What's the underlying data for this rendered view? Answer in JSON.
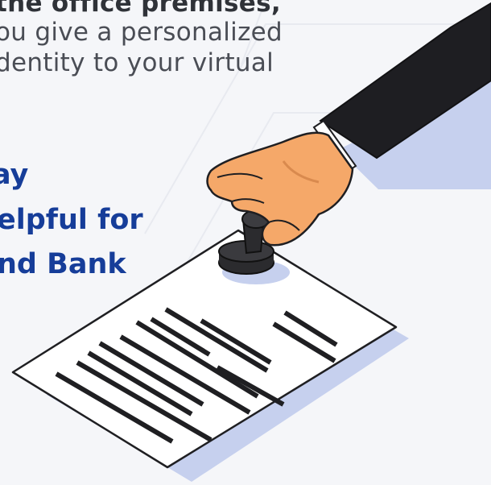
{
  "text": {
    "line1": "the office premises,",
    "line2": "ou give a personalized",
    "line3": "dentity to your virtual",
    "heading1": "ay",
    "heading2": "elpful for",
    "heading3": "nd Bank"
  },
  "colors": {
    "background": "#f5f6f9",
    "body_text": "#4a4d55",
    "heading_text": "#163d99",
    "suit": "#1e1e22",
    "skin": "#f5a869",
    "shadow": "#c6d0ee",
    "stamp": "#2b2b2e"
  },
  "icons": {
    "illustration": "hand-stamping-document"
  }
}
